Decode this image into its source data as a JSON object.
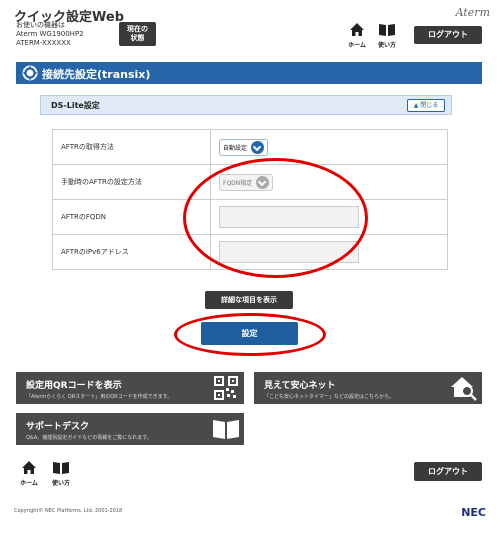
{
  "header": {
    "app_title": "クイック設定Web",
    "device_line1": "お使いの機器は",
    "device_line2": "Aterm WG1900HP2",
    "device_line3": "ATERM-XXXXXX",
    "status_button_line1": "現在の",
    "status_button_line2": "状態",
    "brand": "Aterm",
    "home_label": "ホーム",
    "usage_label": "使い方",
    "logout_label": "ログアウト"
  },
  "section": {
    "title": "接続先設定(transix)"
  },
  "panel": {
    "title": "DS-Lite設定",
    "close_label": "閉じる"
  },
  "rows": [
    {
      "label": "AFTRの取得方法",
      "value": "自動設定",
      "control": "select"
    },
    {
      "label": "手動時のAFTRの設定方法",
      "value": "FQDN指定",
      "control": "select-disabled"
    },
    {
      "label": "AFTRのFQDN",
      "value": "",
      "control": "input"
    },
    {
      "label": "AFTRのIPv6アドレス",
      "value": "",
      "control": "input"
    }
  ],
  "buttons": {
    "detail": "詳細な項目を表示",
    "apply": "設定"
  },
  "tiles": {
    "qr": {
      "title": "設定用QRコードを表示",
      "desc": "「Atermらくらく QRスタート」用のQRコードを作成できます。"
    },
    "net": {
      "title": "見えて安心ネット",
      "desc": "「こども安心ネットタイマー」などの設定はこちらから。"
    },
    "support": {
      "title": "サポートデスク",
      "desc": "Q&A、機能別設定ガイドなどの情報をご覧になれます。"
    }
  },
  "footer": {
    "home_label": "ホーム",
    "usage_label": "使い方",
    "logout_label": "ログアウト",
    "copyright": "Copyright© NEC Platforms, Ltd. 2001-2018",
    "nec_logo": "NEC"
  },
  "colors": {
    "accent_blue": "#2565a8",
    "dark_button": "#3a3a3a",
    "highlight_red": "#e00000"
  }
}
